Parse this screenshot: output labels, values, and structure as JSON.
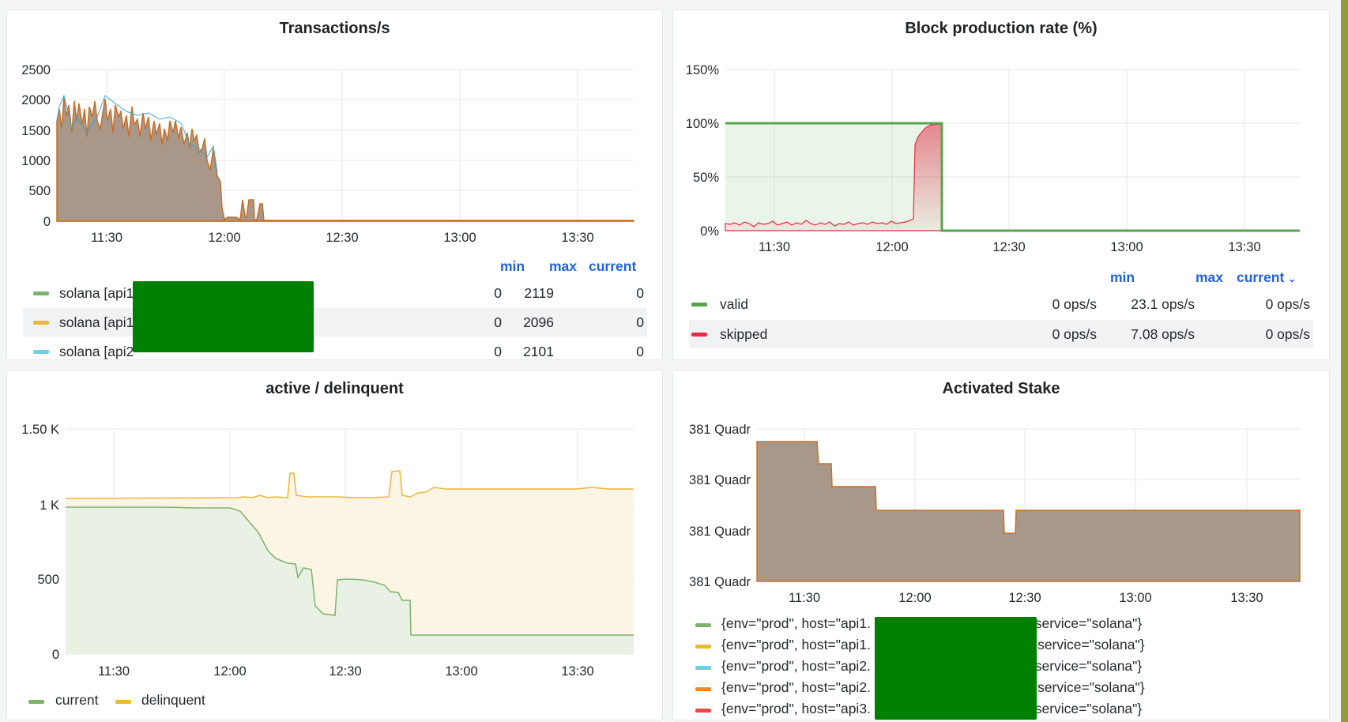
{
  "colors": {
    "green": "#56a64b",
    "yellow": "#f2cc0c",
    "blue": "#5794f2",
    "orange": "#ff780a",
    "red": "#e02f44",
    "cyan": "#73bf69"
  },
  "tx": {
    "title": "Transactions/s",
    "y_ticks": [
      "2500",
      "2000",
      "1500",
      "1000",
      "500",
      "0"
    ],
    "x_ticks": [
      "11:30",
      "12:00",
      "12:30",
      "13:00",
      "13:30"
    ],
    "legend_headers": {
      "min": "min",
      "max": "max",
      "current": "current"
    },
    "rows": [
      {
        "name": "solana [api1",
        "min": "0",
        "max": "2119",
        "current": "0",
        "color": "#7eb26d"
      },
      {
        "name": "solana [api1",
        "min": "0",
        "max": "2096",
        "current": "0",
        "color": "#eab839"
      },
      {
        "name": "solana [api2",
        "min": "0",
        "max": "2101",
        "current": "0",
        "color": "#6ed0e0"
      }
    ]
  },
  "block": {
    "title": "Block production rate (%)",
    "y_ticks": [
      "150%",
      "100%",
      "50%",
      "0%"
    ],
    "x_ticks": [
      "11:30",
      "12:00",
      "12:30",
      "13:00",
      "13:30"
    ],
    "legend_headers": {
      "min": "min",
      "max": "max",
      "current": "current"
    },
    "rows": [
      {
        "name": "valid",
        "min": "0 ops/s",
        "max": "23.1 ops/s",
        "current": "0 ops/s",
        "color": "#56a64b"
      },
      {
        "name": "skipped",
        "min": "0 ops/s",
        "max": "7.08 ops/s",
        "current": "0 ops/s",
        "color": "#e02f44"
      }
    ]
  },
  "active": {
    "title": "active / delinquent",
    "y_ticks": [
      "1.50 K",
      "1 K",
      "500",
      "0"
    ],
    "x_ticks": [
      "11:30",
      "12:00",
      "12:30",
      "13:00",
      "13:30"
    ],
    "legend": [
      {
        "name": "current",
        "color": "#7eb26d"
      },
      {
        "name": "delinquent",
        "color": "#eab839"
      }
    ]
  },
  "stake": {
    "title": "Activated Stake",
    "y_ticks": [
      "381 Quadr",
      "381 Quadr",
      "381 Quadr",
      "381 Quadr"
    ],
    "x_ticks": [
      "11:30",
      "12:00",
      "12:30",
      "13:00",
      "13:30"
    ],
    "legend": [
      {
        "pre": "{env=\"prod\", host=\"api1.",
        "post": ", service=\"solana\"}",
        "color": "#7eb26d"
      },
      {
        "pre": "{env=\"prod\", host=\"api1.",
        "post": "', service=\"solana\"}",
        "color": "#eab839"
      },
      {
        "pre": "{env=\"prod\", host=\"api2.",
        "post": ", service=\"solana\"}",
        "color": "#6ed0e0"
      },
      {
        "pre": "{env=\"prod\", host=\"api2.",
        "post": "', service=\"solana\"}",
        "color": "#ef843c"
      },
      {
        "pre": "{env=\"prod\", host=\"api3.",
        "post": ", service=\"solana\"}",
        "color": "#e24d42"
      }
    ]
  }
}
